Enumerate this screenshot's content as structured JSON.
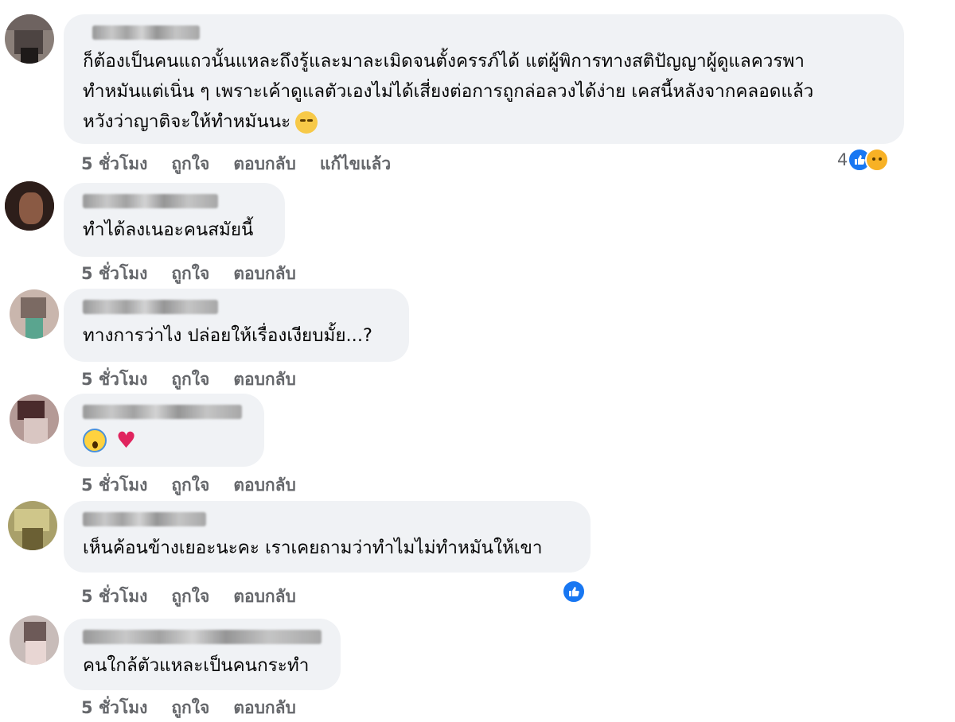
{
  "comments": [
    {
      "text_lines": [
        "ก็ต้องเป็นคนแถวนั้นแหละถึงรู้และมาละเมิดจนตั้งครรภ์ได้ แต่ผู้พิการทางสติปัญญาผู้ดูแลควรพา",
        "ทำหมันแต่เนิ่น ๆ เพราะเค้าดูแลตัวเองไม่ได้เสี่ยงต่อการถูกล่อลวงได้ง่าย เคสนี้หลังจากคลอดแล้ว",
        "หวังว่าญาติจะให้ทำหมันนะ"
      ],
      "time": "5 ชั่วโมง",
      "like": "ถูกใจ",
      "reply": "ตอบกลับ",
      "edited": "แก้ไขแล้ว",
      "reaction_count": "4"
    },
    {
      "text": "ทำได้ลงเนอะคนสมัยนี้",
      "time": "5 ชั่วโมง",
      "like": "ถูกใจ",
      "reply": "ตอบกลับ"
    },
    {
      "text": "ทางการว่าไง ปล่อยให้เรื่องเงียบมั้ย...?",
      "time": "5 ชั่วโมง",
      "like": "ถูกใจ",
      "reply": "ตอบกลับ"
    },
    {
      "emojis": [
        "scream-emoji",
        "red-heart-emoji"
      ],
      "time": "5 ชั่วโมง",
      "like": "ถูกใจ",
      "reply": "ตอบกลับ"
    },
    {
      "text": "เห็นค้อนข้างเยอะนะคะ เราเคยถามว่าทำไมไม่ทำหมันให้เขา",
      "time": "5 ชั่วโมง",
      "like": "ถูกใจ",
      "reply": "ตอบกลับ"
    },
    {
      "text": "คนใกล้ตัวแหละเป็นคนกระทำ",
      "time": "5 ชั่วโมง",
      "like": "ถูกใจ",
      "reply": "ตอบกลับ"
    }
  ],
  "colors": {
    "bubble": "#f0f2f5",
    "meta": "#65676b",
    "like_blue": "#1877f2"
  }
}
